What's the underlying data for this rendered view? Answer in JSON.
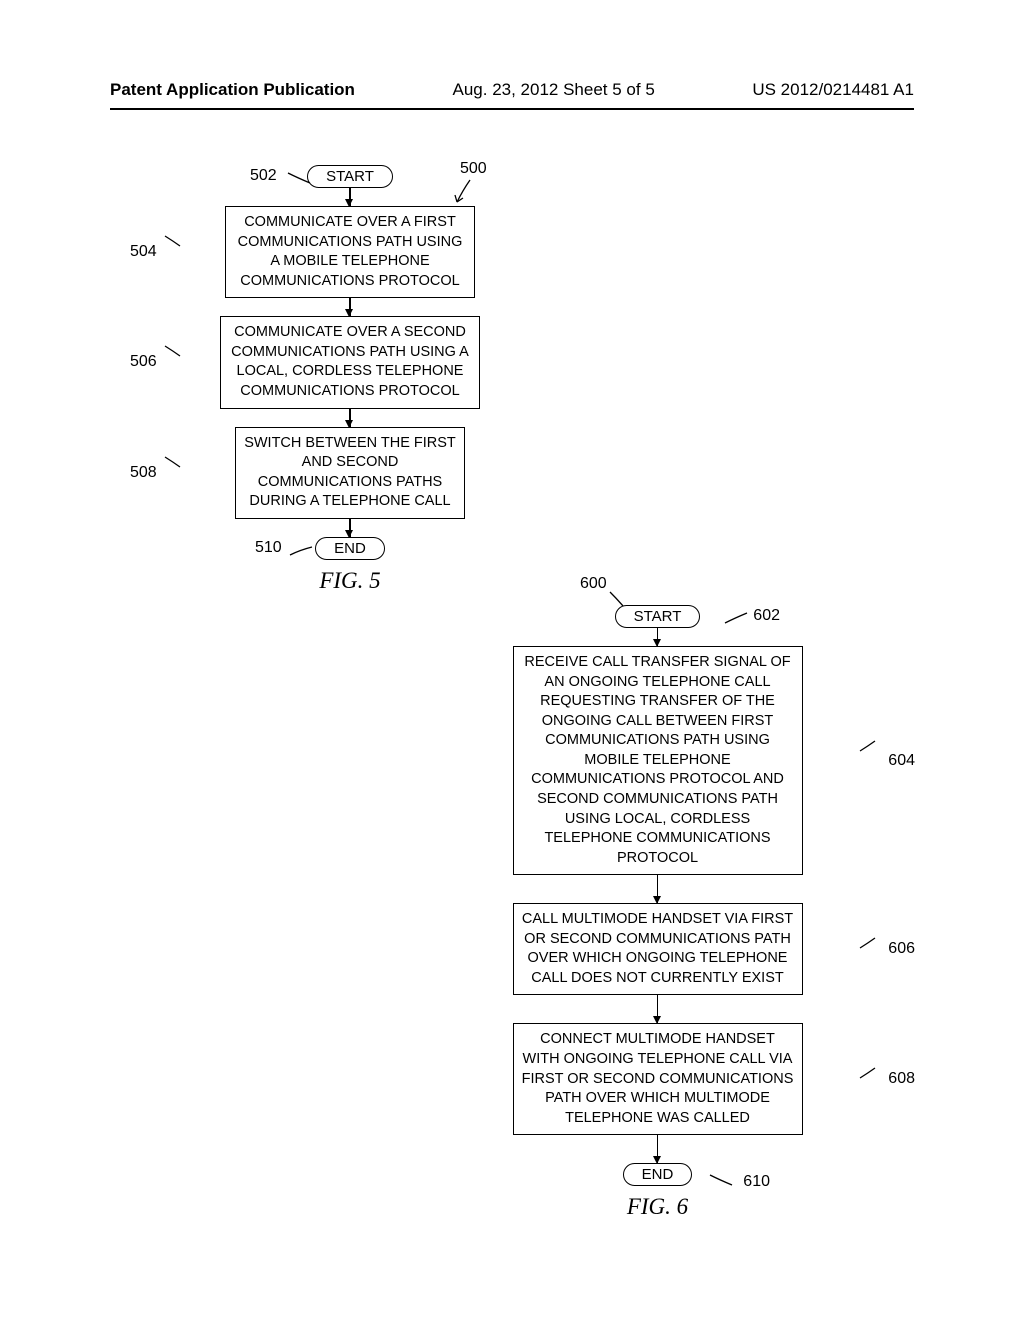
{
  "header": {
    "left": "Patent Application Publication",
    "center": "Aug. 23, 2012   Sheet 5 of 5",
    "right": "US 2012/0214481 A1"
  },
  "fig5": {
    "ref_main": "500",
    "start_label": "START",
    "start_ref": "502",
    "step1": "COMMUNICATE OVER A FIRST COMMUNICATIONS PATH USING A MOBILE TELEPHONE COMMUNICATIONS PROTOCOL",
    "step1_ref": "504",
    "step2": "COMMUNICATE OVER A SECOND COMMUNICATIONS PATH USING A LOCAL, CORDLESS TELEPHONE COMMUNICATIONS PROTOCOL",
    "step2_ref": "506",
    "step3": "SWITCH BETWEEN THE FIRST AND SECOND COMMUNICATIONS PATHS DURING A TELEPHONE CALL",
    "step3_ref": "508",
    "end_label": "END",
    "end_ref": "510",
    "caption": "FIG. 5"
  },
  "fig6": {
    "ref_main": "600",
    "start_label": "START",
    "start_ref": "602",
    "step1": "RECEIVE CALL TRANSFER SIGNAL OF AN ONGOING TELEPHONE CALL REQUESTING TRANSFER OF THE ONGOING CALL BETWEEN FIRST COMMUNICATIONS PATH USING MOBILE TELEPHONE COMMUNICATIONS PROTOCOL AND SECOND COMMUNICATIONS PATH USING LOCAL, CORDLESS TELEPHONE COMMUNICATIONS PROTOCOL",
    "step1_ref": "604",
    "step2": "CALL MULTIMODE HANDSET VIA FIRST OR SECOND COMMUNICATIONS PATH OVER WHICH ONGOING TELEPHONE CALL DOES NOT CURRENTLY EXIST",
    "step2_ref": "606",
    "step3": "CONNECT MULTIMODE HANDSET WITH ONGOING TELEPHONE CALL VIA FIRST OR SECOND COMMUNICATIONS PATH OVER WHICH MULTIMODE TELEPHONE WAS CALLED",
    "step3_ref": "608",
    "end_label": "END",
    "end_ref": "610",
    "caption": "FIG. 6"
  }
}
